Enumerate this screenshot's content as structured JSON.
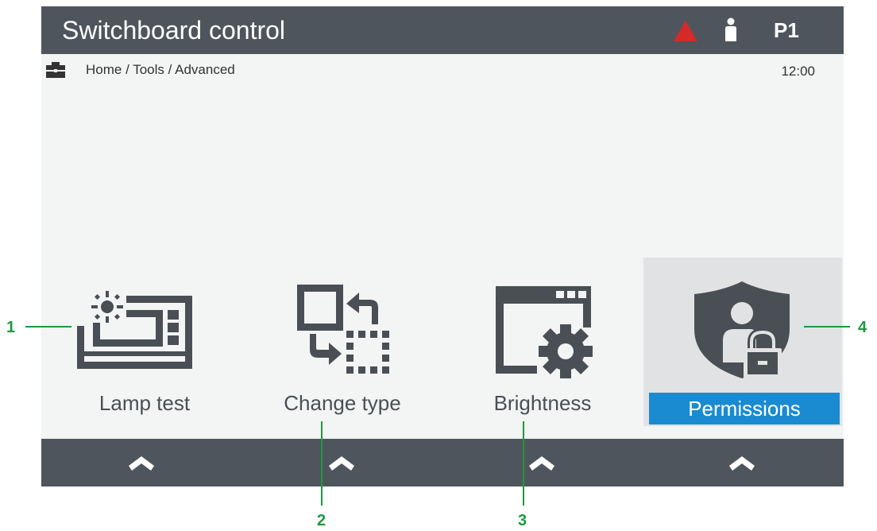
{
  "header": {
    "title": "Switchboard control",
    "page_label": "P1",
    "alarm_color": "#d42a2a",
    "icons": [
      "alarm-triangle-icon",
      "user-icon"
    ]
  },
  "breadcrumb": {
    "path": "Home / Tools / Advanced",
    "time": "12:00",
    "icon": "toolbox-icon"
  },
  "tiles": [
    {
      "label": "Lamp test",
      "icon": "lamp-test-icon"
    },
    {
      "label": "Change type",
      "icon": "change-type-icon"
    },
    {
      "label": "Brightness",
      "icon": "brightness-settings-icon"
    },
    {
      "label": "Permissions",
      "icon": "permissions-shield-icon",
      "selected": true
    }
  ],
  "softkeys": [
    {
      "icon": "chevron-up-icon"
    },
    {
      "icon": "chevron-up-icon"
    },
    {
      "icon": "chevron-up-icon"
    },
    {
      "icon": "chevron-up-icon"
    }
  ],
  "callouts": [
    "1",
    "2",
    "3",
    "4"
  ],
  "colors": {
    "bar": "#4f555c",
    "screen_bg": "#f3f4f4",
    "icon": "#4a4f55",
    "selected_bg": "#e1e2e3",
    "selected_label": "#1a8bd1",
    "callout": "#1c9a3e"
  }
}
